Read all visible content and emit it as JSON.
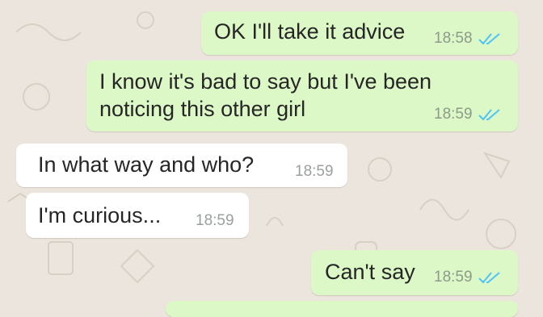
{
  "colors": {
    "wallpaper": "#ece5dd",
    "outgoing_bubble": "#dcf8c6",
    "incoming_bubble": "#ffffff",
    "read_ticks": "#4fc3f7",
    "timestamp": "#8e9a8a"
  },
  "messages": [
    {
      "direction": "outgoing",
      "lines": [
        "OK I'll take it advice"
      ],
      "time": "18:58",
      "status": "read"
    },
    {
      "direction": "outgoing",
      "lines": [
        "I know it's bad to say but I've been",
        "noticing this other girl"
      ],
      "time": "18:59",
      "status": "read"
    },
    {
      "direction": "incoming",
      "lines": [
        "In what way and who?"
      ],
      "time": "18:59"
    },
    {
      "direction": "incoming",
      "lines": [
        "I'm curious..."
      ],
      "time": "18:59"
    },
    {
      "direction": "outgoing",
      "lines": [
        "Can't say"
      ],
      "time": "18:59",
      "status": "read"
    }
  ],
  "icons": {
    "read_status": "double-check-icon"
  }
}
